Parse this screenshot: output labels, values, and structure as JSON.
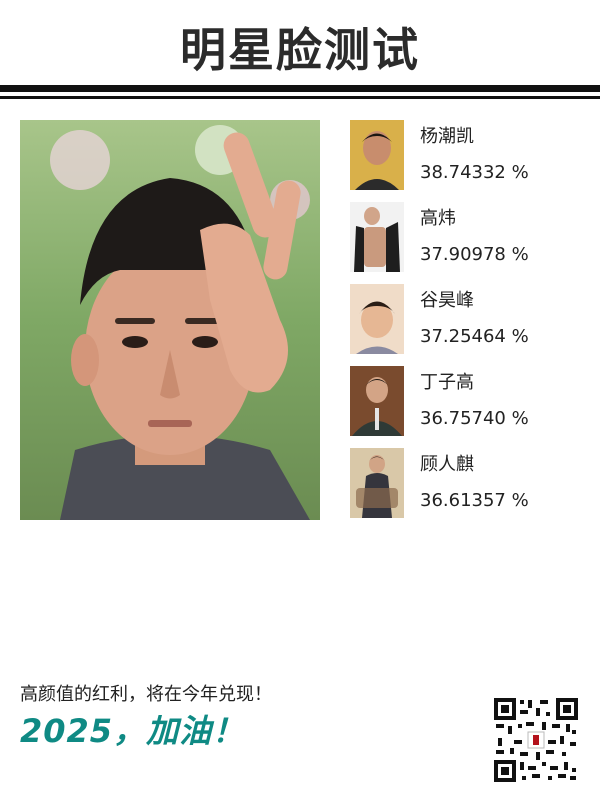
{
  "header": {
    "title": "明星脸测试"
  },
  "matches": [
    {
      "name": "杨潮凯",
      "score": "38.74332 %"
    },
    {
      "name": "高炜",
      "score": "37.90978 %"
    },
    {
      "name": "谷昊峰",
      "score": "37.25464 %"
    },
    {
      "name": "丁子高",
      "score": "36.75740 %"
    },
    {
      "name": "顾人麒",
      "score": "36.61357 %"
    }
  ],
  "footer": {
    "line1": "高颜值的红利，将在今年兑现！",
    "line2": "2025，加油！"
  },
  "colors": {
    "accent": "#0f8a84",
    "rule": "#111111"
  },
  "icons": {
    "qr": "qr-code-icon"
  }
}
